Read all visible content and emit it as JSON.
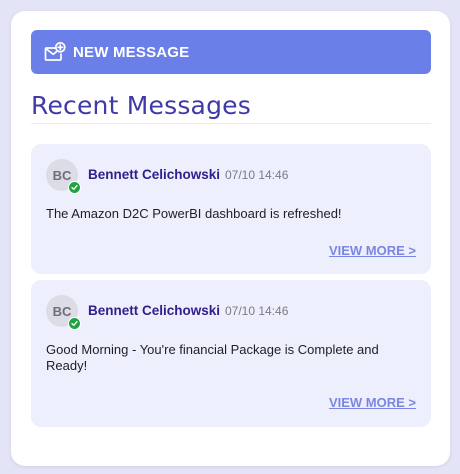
{
  "actions": {
    "new_message_label": "NEW MESSAGE"
  },
  "section": {
    "title": "Recent Messages"
  },
  "messages": [
    {
      "avatar_initials": "BC",
      "sender": "Bennett Celichowski",
      "timestamp": "07/10 14:46",
      "body": "The Amazon D2C PowerBI dashboard is refreshed!",
      "status": "online",
      "view_more_label": "VIEW MORE >"
    },
    {
      "avatar_initials": "BC",
      "sender": "Bennett Celichowski",
      "timestamp": "07/10 14:46",
      "body": "Good Morning - You're financial Package is Complete and Ready!",
      "status": "online",
      "view_more_label": "VIEW MORE >"
    }
  ],
  "colors": {
    "background": "#e4e4f7",
    "accent": "#6b7fe9",
    "title": "#3e3aa8",
    "sender": "#2e1f8a",
    "card": "#eeeffd",
    "link": "#7b86e0",
    "online": "#22a341"
  },
  "icons": {
    "new_message": "envelope-plus-icon",
    "status": "check-icon"
  }
}
